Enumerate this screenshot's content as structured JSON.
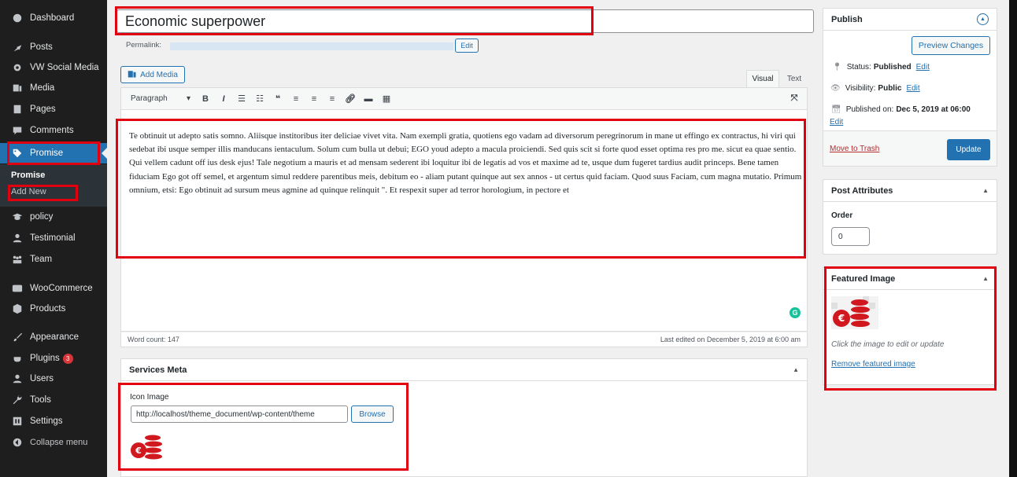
{
  "sidebar": {
    "items": [
      {
        "label": "Dashboard",
        "icon": "dashboard-icon"
      },
      {
        "label": "Posts",
        "icon": "pin-icon"
      },
      {
        "label": "VW Social Media",
        "icon": "gear-icon"
      },
      {
        "label": "Media",
        "icon": "media-icon"
      },
      {
        "label": "Pages",
        "icon": "pages-icon"
      },
      {
        "label": "Comments",
        "icon": "comments-icon"
      },
      {
        "label": "Promise",
        "icon": "tag-icon"
      },
      {
        "label": "policy",
        "icon": "graduation-cap-icon"
      },
      {
        "label": "Testimonial",
        "icon": "users-icon"
      },
      {
        "label": "Team",
        "icon": "team-icon"
      },
      {
        "label": "WooCommerce",
        "icon": "woo-icon"
      },
      {
        "label": "Products",
        "icon": "products-icon"
      },
      {
        "label": "Appearance",
        "icon": "brush-icon"
      },
      {
        "label": "Plugins",
        "icon": "plug-icon",
        "badge": "3"
      },
      {
        "label": "Users",
        "icon": "user-icon"
      },
      {
        "label": "Tools",
        "icon": "wrench-icon"
      },
      {
        "label": "Settings",
        "icon": "settings-icon"
      },
      {
        "label": "Collapse menu",
        "icon": "collapse-icon"
      }
    ],
    "submenu": {
      "current": "Promise",
      "add_new": "Add New"
    }
  },
  "editor": {
    "title": "Economic superpower",
    "permalink_label": "Permalink:",
    "edit_label": "Edit",
    "add_media": "Add Media",
    "tab_visual": "Visual",
    "tab_text": "Text",
    "format": "Paragraph",
    "content": "Te obtinuit ut adepto satis somno. Aliisque institoribus iter deliciae vivet vita. Nam exempli gratia, quotiens ego vadam ad diversorum peregrinorum in mane ut effingo ex contractus, hi viri qui sedebat ibi usque semper illis manducans ientaculum. Solum cum bulla ut debui; EGO youd adepto a macula proiciendi. Sed quis scit si forte quod esset optima res pro me. sicut ea quae sentio. Qui vellem cadunt off ius desk ejus! Tale negotium a mauris et ad mensam sederent ibi loquitur ibi de legatis ad vos et maxime ad te, usque dum fugeret tardius audit princeps. Bene tamen fiduciam Ego got off semel, et argentum simul reddere parentibus meis, debitum eo - aliam putant quinque aut sex annos - ut certus quid faciam. Quod suus Faciam, cum magna mutatio. Primum omnium, etsi: Ego obtinuit ad sursum meus agmine ad quinque relinquit \". Et respexit super ad terror horologium, in pectore et",
    "word_count": "Word count: 147",
    "last_edited": "Last edited on December 5, 2019 at 6:00 am"
  },
  "services_meta": {
    "title": "Services Meta",
    "icon_label": "Icon Image",
    "icon_value": "http://localhost/theme_document/wp-content/theme",
    "browse": "Browse"
  },
  "publish": {
    "title": "Publish",
    "preview": "Preview Changes",
    "status_label": "Status:",
    "status_value": "Published",
    "visibility_label": "Visibility:",
    "visibility_value": "Public",
    "published_label": "Published on:",
    "published_value": "Dec 5, 2019 at 06:00",
    "edit": "Edit",
    "trash": "Move to Trash",
    "update": "Update"
  },
  "attributes": {
    "title": "Post Attributes",
    "order_label": "Order",
    "order_value": "0"
  },
  "featured": {
    "title": "Featured Image",
    "hint": "Click the image to edit or update",
    "remove": "Remove featured image"
  },
  "colors": {
    "accent": "#2271b1",
    "highlight": "#e0000f",
    "sidebar": "#1e1e1e"
  }
}
